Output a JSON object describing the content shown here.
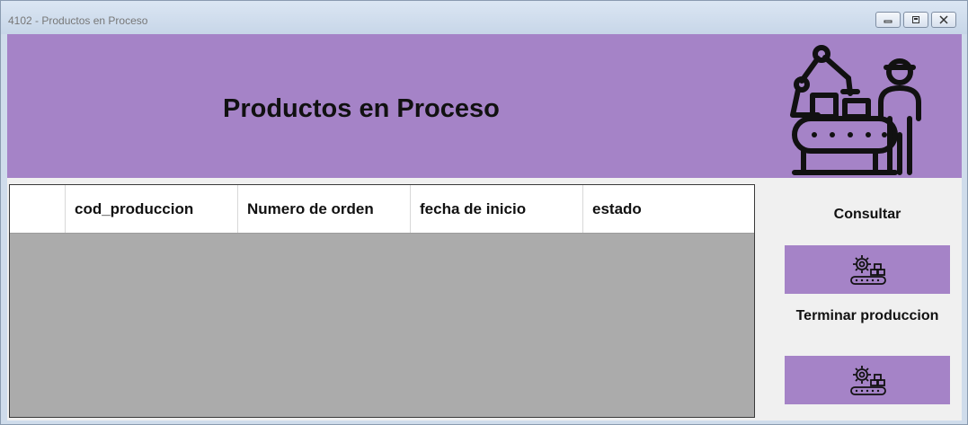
{
  "window": {
    "title": "4102 - Productos en Proceso",
    "controls": [
      "minimize-icon",
      "restore-icon",
      "close-icon"
    ]
  },
  "header": {
    "title": "Productos en Proceso",
    "logo_icon": "assembly-line-worker-robot-icon",
    "background": "#a583c7"
  },
  "grid": {
    "columns": [
      "",
      "cod_produccion",
      "Numero de orden",
      "fecha de inicio",
      "estado"
    ],
    "rows": [],
    "empty_area_color": "#ababab"
  },
  "actions": {
    "consultar_label": "Consultar",
    "consultar_icon": "gear-conveyor-icon",
    "terminar_label": "Terminar produccion",
    "terminar_icon": "gear-conveyor-icon",
    "button_color": "#a583c7"
  }
}
